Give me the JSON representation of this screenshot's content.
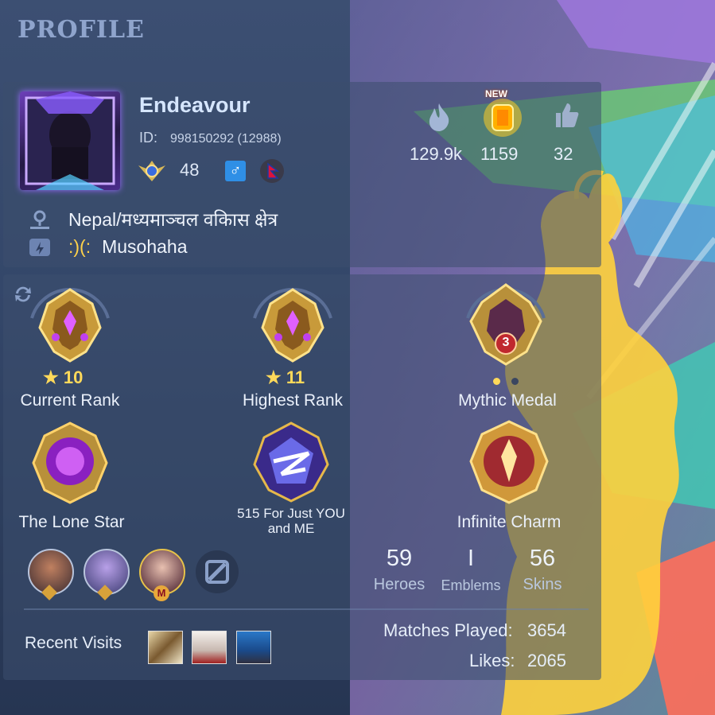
{
  "header": {
    "title": "PROFILE"
  },
  "profile": {
    "name": "Endeavour",
    "id_label": "ID:",
    "id_value": "998150292 (12988)",
    "level": "48",
    "location": "Nepal/मध्यमाञ्चल वकिास क्षेत्र",
    "squad_tag": ":)(:",
    "squad_name": "Musohaha"
  },
  "stats": {
    "popularity": "129.9k",
    "charisma": "1159",
    "charisma_badge": "NEW",
    "likes_top": "32"
  },
  "medals": [
    {
      "label": "Current Rank",
      "stars": "10"
    },
    {
      "label": "Highest Rank",
      "stars": "11"
    },
    {
      "label": "Mythic Medal",
      "badge": "3"
    },
    {
      "label": "The Lone Star"
    },
    {
      "label_line1": "515 For Just YOU",
      "label_line2": "and ME"
    },
    {
      "label": "Infinite Charm"
    }
  ],
  "collection": {
    "heroes_value": "59",
    "heroes_label": "Heroes",
    "emblems_value": "I",
    "emblems_label": "Emblems",
    "skins_value": "56",
    "skins_label": "Skins"
  },
  "footer": {
    "recent_visits_label": "Recent Visits",
    "matches_label": "Matches Played:",
    "matches_value": "3654",
    "likes_label": "Likes:",
    "likes_value": "2065"
  },
  "colors": {
    "accent_gold": "#ffd95a",
    "panel": "#3c4e6e",
    "title": "#8fa4cc"
  },
  "icons": [
    "location-icon",
    "squad-icon",
    "swap-icon",
    "fire-icon",
    "lantern-icon",
    "thumbs-up-icon",
    "level-wings-icon",
    "male-icon",
    "nepal-flag-icon",
    "star-icon",
    "edit-icon"
  ]
}
